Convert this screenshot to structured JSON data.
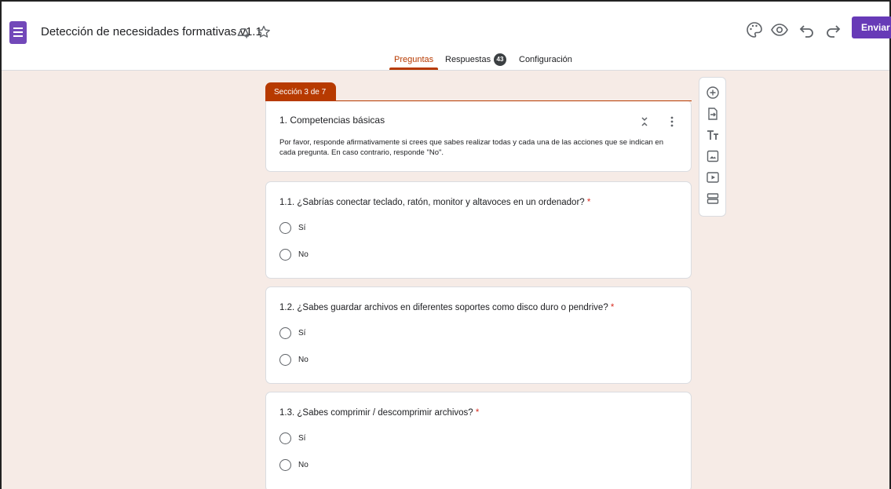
{
  "header": {
    "doc_title": "Detección de necesidades formativas v1.1",
    "send_label": "Enviar",
    "icons": [
      "forms-logo-icon",
      "move-to-folder-icon",
      "star-icon",
      "palette-icon",
      "preview-eye-icon",
      "undo-icon",
      "redo-icon"
    ]
  },
  "tabs": [
    {
      "label": "Preguntas",
      "active": true
    },
    {
      "label": "Respuestas",
      "badge": "43"
    },
    {
      "label": "Configuración"
    }
  ],
  "colors": {
    "accent": "#b73a00",
    "send": "#673ab7",
    "background": "#f6ebe6"
  },
  "section": {
    "tab_label": "Sección 3 de 7",
    "title": "1. Competencias básicas",
    "description": "Por favor, responde afirmativamente si crees que sabes realizar todas y cada una de las acciones que se indican en cada pregunta. En caso contrario, responde \"No\"."
  },
  "questions": [
    {
      "title": "1.1. ¿Sabrías conectar teclado, ratón, monitor y altavoces en un ordenador?",
      "required": "*",
      "options": [
        "Sí",
        "No"
      ]
    },
    {
      "title": "1.2. ¿Sabes guardar archivos en diferentes soportes como disco duro o pendrive?",
      "required": "*",
      "options": [
        "Sí",
        "No"
      ]
    },
    {
      "title": "1.3. ¿Sabes comprimir / descomprimir archivos?",
      "required": "*",
      "options": [
        "Sí",
        "No"
      ]
    }
  ],
  "toolbar": {
    "items": [
      "add-question-icon",
      "import-questions-icon",
      "add-title-icon",
      "add-image-icon",
      "add-video-icon",
      "add-section-icon"
    ]
  }
}
